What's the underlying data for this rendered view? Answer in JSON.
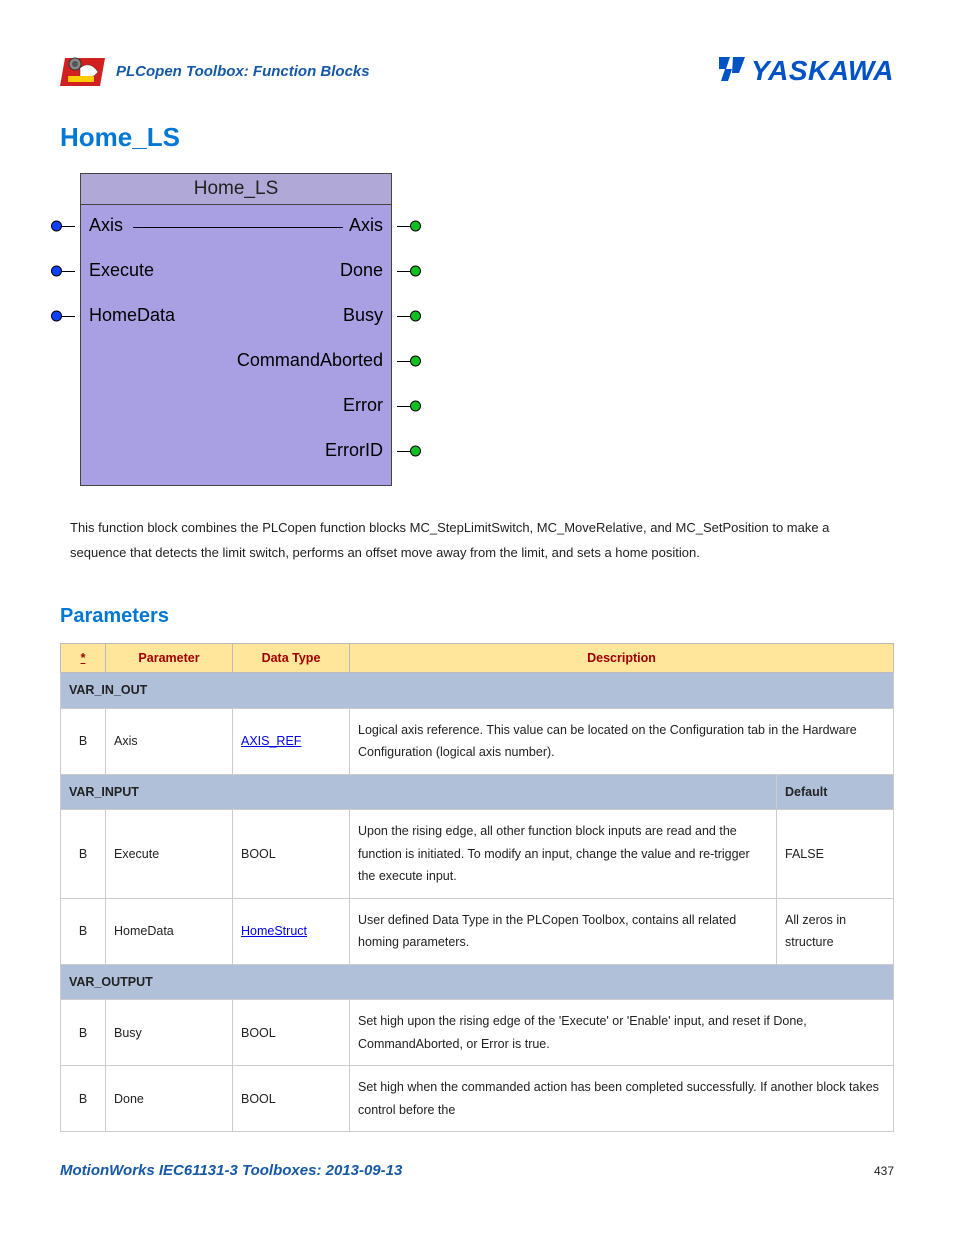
{
  "header": {
    "subtitle": "PLCopen Toolbox: Function Blocks",
    "brand": "YASKAWA"
  },
  "page": {
    "title": "Home_LS",
    "description": "This function block combines the PLCopen function blocks MC_StepLimitSwitch, MC_MoveRelative, and MC_SetPosition to make a sequence that detects the limit switch, performs an offset move away from the limit, and sets a home position."
  },
  "fb": {
    "title": "Home_LS",
    "inputs": [
      "Axis",
      "Execute",
      "HomeData"
    ],
    "outputs": [
      "Axis",
      "Done",
      "Busy",
      "CommandAborted",
      "Error",
      "ErrorID"
    ]
  },
  "parameters": {
    "heading": "Parameters",
    "columns": {
      "star": "*",
      "param": "Parameter",
      "type": "Data Type",
      "desc": "Description",
      "default": "Default"
    },
    "sections": {
      "var_in_out": "VAR_IN_OUT",
      "var_input": "VAR_INPUT",
      "var_output": "VAR_OUTPUT"
    },
    "rows": {
      "axis": {
        "b": "B",
        "param": "Axis",
        "type": "AXIS_REF",
        "desc": "Logical axis reference. This value can be located on the Configuration tab in the Hardware Configuration (logical axis number)."
      },
      "execute": {
        "b": "B",
        "param": "Execute",
        "type": "BOOL",
        "desc": "Upon the rising edge, all other function block inputs are read and the function is initiated. To modify an input, change the value and re-trigger the execute input.",
        "default": "FALSE"
      },
      "homedata": {
        "b": "B",
        "param": "HomeData",
        "type": "HomeStruct",
        "desc": "User defined Data Type in the PLCopen Toolbox, contains all related homing parameters.",
        "default": "All zeros in structure"
      },
      "busy": {
        "b": "B",
        "param": "Busy",
        "type": "BOOL",
        "desc": "Set high upon the rising edge of the 'Execute' or 'Enable' input, and reset if Done, CommandAborted, or Error is true."
      },
      "done": {
        "b": "B",
        "param": "Done",
        "type": "BOOL",
        "desc": "Set high when the commanded action has been completed successfully. If another block takes control before the"
      }
    }
  },
  "footer": {
    "text": "MotionWorks IEC61131-3 Toolboxes: 2013-09-13",
    "page": "437"
  }
}
